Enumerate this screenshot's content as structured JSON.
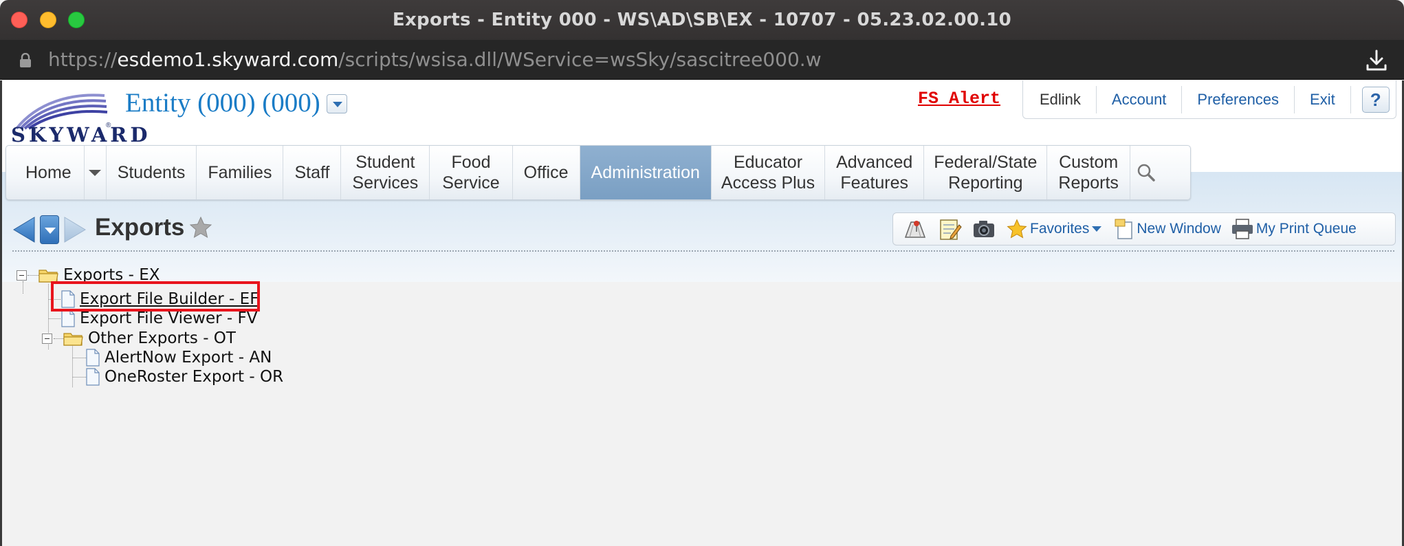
{
  "window": {
    "title": "Exports - Entity 000 - WS\\AD\\SB\\EX - 10707 - 05.23.02.00.10",
    "url_scheme": "https://",
    "url_host": "esdemo1.skyward.com",
    "url_path": "/scripts/wsisa.dll/WService=wsSky/sascitree000.w"
  },
  "header": {
    "logo_text": "SKYWARD",
    "entity_title": "Entity (000) (000)",
    "alert_label": "FS Alert",
    "utility_links": [
      "Edlink",
      "Account",
      "Preferences",
      "Exit"
    ],
    "help_label": "?"
  },
  "main_nav": {
    "items": [
      {
        "label": "Home"
      },
      {
        "label": "Students"
      },
      {
        "label": "Families"
      },
      {
        "label": "Staff"
      },
      {
        "label": "Student\nServices"
      },
      {
        "label": "Food\nService"
      },
      {
        "label": "Office"
      },
      {
        "label": "Administration",
        "active": true
      },
      {
        "label": "Educator\nAccess Plus"
      },
      {
        "label": "Advanced\nFeatures"
      },
      {
        "label": "Federal/State\nReporting"
      },
      {
        "label": "Custom\nReports"
      }
    ]
  },
  "page": {
    "title": "Exports",
    "toolbar": {
      "favorites_label": "Favorites",
      "new_window_label": "New Window",
      "print_queue_label": "My Print Queue"
    }
  },
  "tree": {
    "root": "Exports - EX",
    "items": [
      {
        "label": "Export File Builder - EF",
        "highlighted": true
      },
      {
        "label": "Export File Viewer - FV"
      }
    ],
    "subfolder": {
      "label": "Other Exports - OT",
      "items": [
        {
          "label": "AlertNow Export - AN"
        },
        {
          "label": "OneRoster Export - OR"
        }
      ]
    }
  },
  "colors": {
    "accent_blue": "#1a7cc6",
    "link_blue": "#1f5fa6",
    "alert_red": "#e00000",
    "highlight_red": "#e8141c",
    "active_nav": "#7a9fc3"
  },
  "icons": {
    "lock": "lock-icon",
    "download": "download-icon",
    "search": "search-icon",
    "favorite_star": "star-icon",
    "folder": "folder-icon",
    "document": "document-icon"
  }
}
